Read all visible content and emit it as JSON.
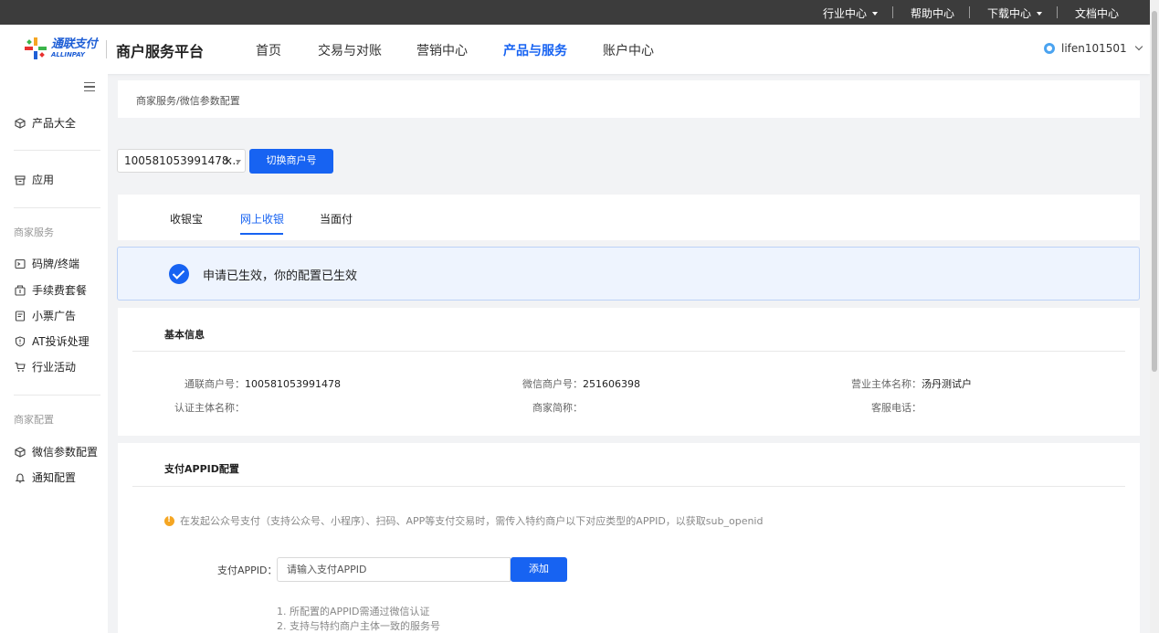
{
  "topbar": {
    "industry": "行业中心",
    "help": "帮助中心",
    "download": "下载中心",
    "docs": "文档中心"
  },
  "header": {
    "logo_cn": "通联支付",
    "logo_en": "ALLINPAY",
    "platform": "商户服务平台",
    "nav": [
      "首页",
      "交易与对账",
      "营销中心",
      "产品与服务",
      "账户中心"
    ],
    "active_nav": "产品与服务",
    "username": "lifen101501"
  },
  "sidebar": {
    "products": "产品大全",
    "apps": "应用",
    "group_merchant_service": "商家服务",
    "service_items": [
      "码牌/终端",
      "手续费套餐",
      "小票广告",
      "AT投诉处理",
      "行业活动"
    ],
    "group_merchant_config": "商家配置",
    "config_items": [
      "微信参数配置",
      "通知配置"
    ]
  },
  "breadcrumb": "商家服务/微信参数配置",
  "merchant_select": {
    "value": "100581053991478...",
    "switch_label": "切换商户号"
  },
  "tabs": [
    "收银宝",
    "网上收银",
    "当面付"
  ],
  "active_tab": "网上收银",
  "notice": "申请已生效，你的配置已生效",
  "basic_info": {
    "title": "基本信息",
    "fields": {
      "allinpay_no_label": "通联商户号：",
      "allinpay_no": "100581053991478",
      "wechat_no_label": "微信商户号：",
      "wechat_no": "251606398",
      "entity_label": "营业主体名称：",
      "entity": "汤丹测试户",
      "cert_label": "认证主体名称：",
      "cert": "",
      "short_label": "商家简称：",
      "short": "",
      "phone_label": "客服电话：",
      "phone": ""
    }
  },
  "appid_config": {
    "title": "支付APPID配置",
    "warning": "在发起公众号支付（支持公众号、小程序）、扫码、APP等支付交易时，需传入特约商户以下对应类型的APPID，以获取sub_openid",
    "label": "支付APPID：",
    "placeholder": "请输入支付APPID",
    "add_label": "添加",
    "notes": [
      "1. 所配置的APPID需通过微信认证",
      "2. 支持与特约商户主体一致的服务号"
    ]
  },
  "colors": {
    "primary": "#1763f2",
    "topbar": "#3c3c3c",
    "notice_bg": "#eef4fe",
    "warning": "#f5a623"
  }
}
